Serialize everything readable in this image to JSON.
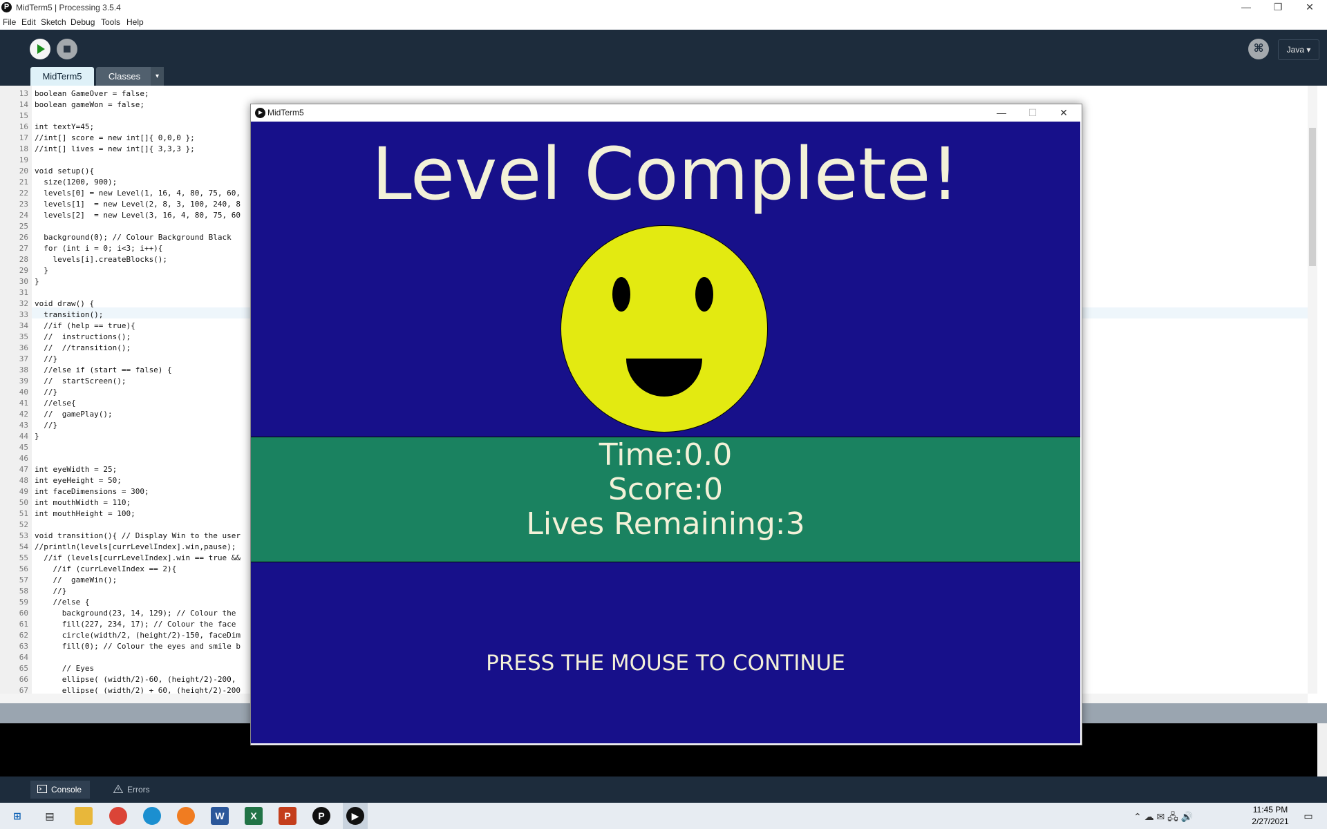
{
  "window": {
    "title": "MidTerm5 | Processing 3.5.4",
    "app_icon": "processing-logo-icon",
    "controls": {
      "minimize": "—",
      "restore": "❐",
      "close": "✕"
    }
  },
  "menu": [
    "File",
    "Edit",
    "Sketch",
    "Debug",
    "Tools",
    "Help"
  ],
  "toolbar": {
    "run_icon": "play-icon",
    "stop_icon": "stop-icon",
    "debug_icon": "debugger-icon",
    "mode_label": "Java ▾"
  },
  "tabs": [
    {
      "label": "MidTerm5",
      "active": true
    },
    {
      "label": "Classes",
      "active": false
    }
  ],
  "tab_menu_label": "▾",
  "editor": {
    "current_line": 33,
    "lines": [
      {
        "n": "13",
        "code": "boolean GameOver = false;"
      },
      {
        "n": "14",
        "code": "boolean gameWon = false;"
      },
      {
        "n": "15",
        "code": ""
      },
      {
        "n": "16",
        "code": "int textY=45;"
      },
      {
        "n": "17",
        "code": "//int[] score = new int[]{ 0,0,0 };"
      },
      {
        "n": "18",
        "code": "//int[] lives = new int[]{ 3,3,3 };"
      },
      {
        "n": "19",
        "code": ""
      },
      {
        "n": "20",
        "code": "void setup(){"
      },
      {
        "n": "21",
        "code": "  size(1200, 900);"
      },
      {
        "n": "22",
        "code": "  levels[0] = new Level(1, 16, 4, 80, 75, 60,"
      },
      {
        "n": "23",
        "code": "  levels[1]  = new Level(2, 8, 3, 100, 240, 8"
      },
      {
        "n": "24",
        "code": "  levels[2]  = new Level(3, 16, 4, 80, 75, 60"
      },
      {
        "n": "25",
        "code": ""
      },
      {
        "n": "26",
        "code": "  background(0); // Colour Background Black"
      },
      {
        "n": "27",
        "code": "  for (int i = 0; i<3; i++){"
      },
      {
        "n": "28",
        "code": "    levels[i].createBlocks();"
      },
      {
        "n": "29",
        "code": "  }"
      },
      {
        "n": "30",
        "code": "}"
      },
      {
        "n": "31",
        "code": ""
      },
      {
        "n": "32",
        "code": "void draw() {"
      },
      {
        "n": "33",
        "code": "  transition();"
      },
      {
        "n": "34",
        "code": "  //if (help == true){"
      },
      {
        "n": "35",
        "code": "  //  instructions();"
      },
      {
        "n": "36",
        "code": "  //  //transition();"
      },
      {
        "n": "37",
        "code": "  //}"
      },
      {
        "n": "38",
        "code": "  //else if (start == false) {"
      },
      {
        "n": "39",
        "code": "  //  startScreen();"
      },
      {
        "n": "40",
        "code": "  //}"
      },
      {
        "n": "41",
        "code": "  //else{"
      },
      {
        "n": "42",
        "code": "  //  gamePlay();"
      },
      {
        "n": "43",
        "code": "  //}"
      },
      {
        "n": "44",
        "code": "}"
      },
      {
        "n": "45",
        "code": ""
      },
      {
        "n": "46",
        "code": ""
      },
      {
        "n": "47",
        "code": "int eyeWidth = 25;"
      },
      {
        "n": "48",
        "code": "int eyeHeight = 50;"
      },
      {
        "n": "49",
        "code": "int faceDimensions = 300;"
      },
      {
        "n": "50",
        "code": "int mouthWidth = 110;"
      },
      {
        "n": "51",
        "code": "int mouthHeight = 100;"
      },
      {
        "n": "52",
        "code": ""
      },
      {
        "n": "53",
        "code": "void transition(){ // Display Win to the user"
      },
      {
        "n": "54",
        "code": "//println(levels[currLevelIndex].win,pause);"
      },
      {
        "n": "55",
        "code": "  //if (levels[currLevelIndex].win == true &&"
      },
      {
        "n": "56",
        "code": "    //if (currLevelIndex == 2){"
      },
      {
        "n": "57",
        "code": "    //  gameWin();"
      },
      {
        "n": "58",
        "code": "    //}"
      },
      {
        "n": "59",
        "code": "    //else {"
      },
      {
        "n": "60",
        "code": "      background(23, 14, 129); // Colour the"
      },
      {
        "n": "61",
        "code": "      fill(227, 234, 17); // Colour the face"
      },
      {
        "n": "62",
        "code": "      circle(width/2, (height/2)-150, faceDim"
      },
      {
        "n": "63",
        "code": "      fill(0); // Colour the eyes and smile b"
      },
      {
        "n": "64",
        "code": ""
      },
      {
        "n": "65",
        "code": "      // Eyes"
      },
      {
        "n": "66",
        "code": "      ellipse( (width/2)-60, (height/2)-200,"
      },
      {
        "n": "67",
        "code": "      ellipse( (width/2) + 60, (height/2)-200"
      }
    ]
  },
  "footer": {
    "console_label": "Console",
    "errors_label": "Errors"
  },
  "sketch": {
    "title": "MidTerm5",
    "controls": {
      "minimize": "—",
      "maximize": "☐",
      "close": "✕"
    },
    "heading": "Level Complete!",
    "time_text": "Time:0.0",
    "score_text": "Score:0",
    "lives_text": "Lives Remaining:3",
    "prompt": "PRESS THE MOUSE TO CONTINUE",
    "colors": {
      "background": "#17108a",
      "face": "#e3ea11",
      "stats_band": "#1a8260",
      "text": "#f3f1d8"
    }
  },
  "taskbar": {
    "apps": [
      "windows-start-icon",
      "task-view-icon",
      "file-explorer-icon",
      "chrome-icon",
      "edge-icon",
      "firefox-icon",
      "word-icon",
      "excel-icon",
      "powerpoint-icon",
      "processing-icon",
      "java-sketch-icon"
    ],
    "time": "11:45 PM",
    "date": "2/27/2021"
  }
}
